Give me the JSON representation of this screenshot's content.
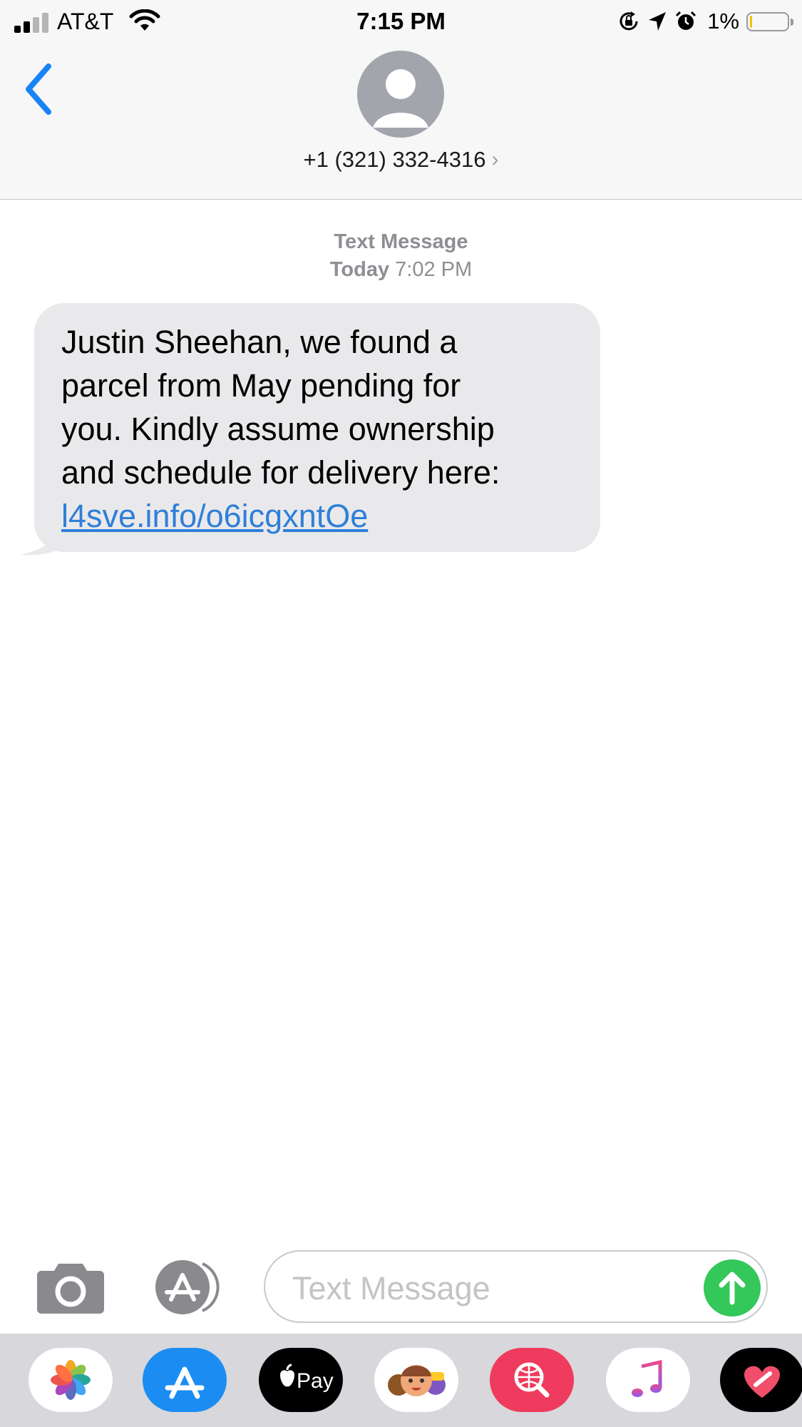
{
  "status_bar": {
    "carrier": "AT&T",
    "time": "7:15 PM",
    "battery_percent": "1%",
    "battery_level": 0.01,
    "icons": [
      "signal-icon",
      "wifi-icon",
      "orientation-lock-icon",
      "location-arrow-icon",
      "alarm-icon",
      "battery-icon"
    ]
  },
  "header": {
    "back_icon": "chevron-left-icon",
    "contact_name": "+1 (321) 332-4316",
    "contact_chevron": "›",
    "accent_color": "#1a82f7"
  },
  "conversation": {
    "service_label": "Text Message",
    "day": "Today",
    "time": "7:02 PM",
    "messages": [
      {
        "direction": "incoming",
        "line1": "Justin Sheehan, we found a",
        "line2": "parcel from May pending for",
        "line3": "you. Kindly assume ownership",
        "line4": "and schedule for delivery here:",
        "link": "l4sve.info/o6icgxntOe",
        "bubble_color": "#e9e9eb",
        "link_color": "#2f7fd9"
      }
    ]
  },
  "composer": {
    "camera_icon": "camera-icon",
    "apps_icon": "app-store-icon",
    "placeholder": "Text Message",
    "send_icon": "send-arrow-icon",
    "send_color": "#34c759"
  },
  "app_drawer": {
    "apps": [
      {
        "icon": "photos-icon"
      },
      {
        "icon": "app-store-icon"
      },
      {
        "icon": "apple-pay-icon",
        "label": "Pay"
      },
      {
        "icon": "memoji-icon"
      },
      {
        "icon": "web-search-icon"
      },
      {
        "icon": "music-icon"
      },
      {
        "icon": "digital-touch-icon"
      }
    ]
  }
}
